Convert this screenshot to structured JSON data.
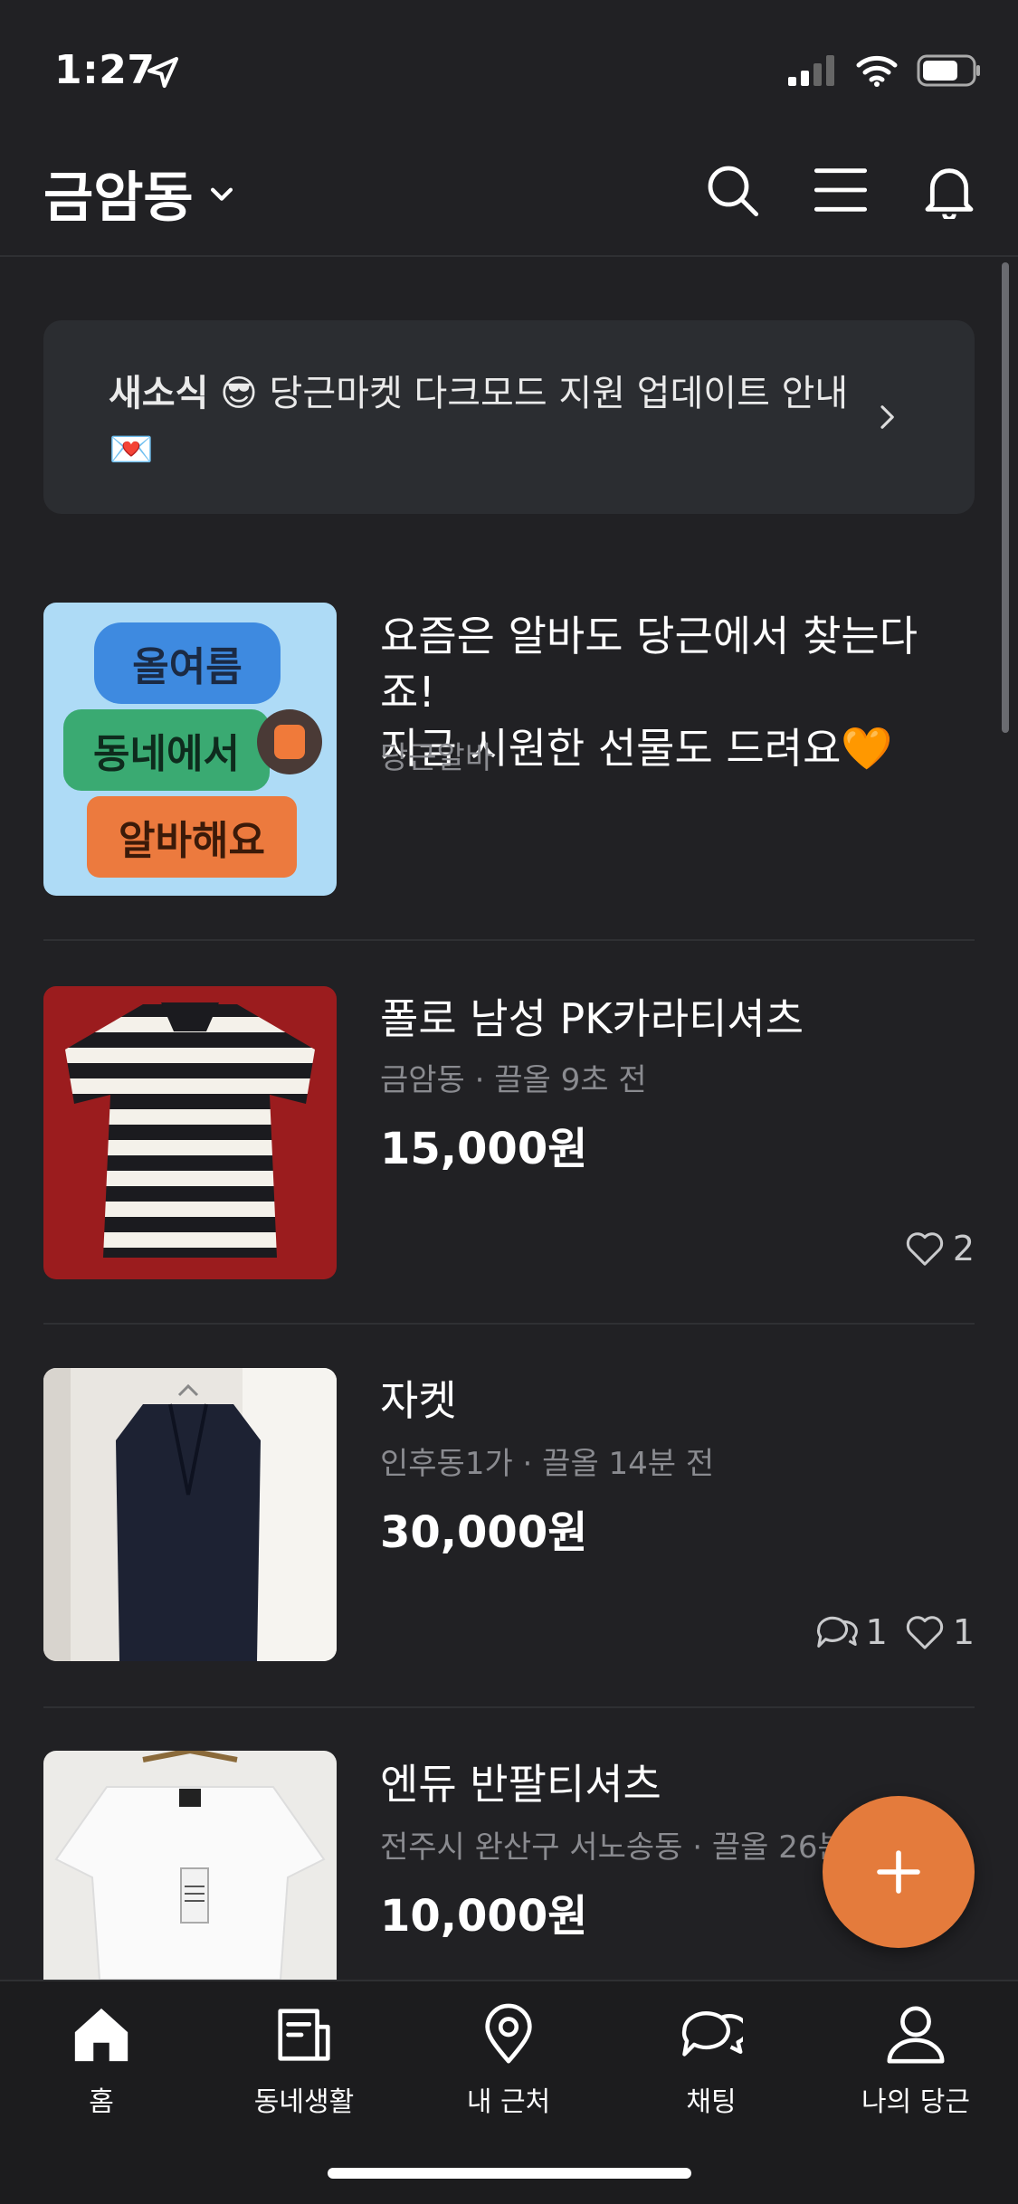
{
  "status_bar": {
    "time": "1:27"
  },
  "header": {
    "location": "금암동"
  },
  "notice": {
    "tag": "새소식",
    "text_before_emoji": "😎",
    "message": "당근마켓 다크모드 지원 업데이트 안내",
    "trailing_emoji": "💌"
  },
  "ad": {
    "title_line1": "요즘은 알바도 당근에서 찾는다죠!",
    "title_line2": "지금 시원한 선물도 드려요",
    "heart_emoji": "🧡",
    "source": "당근알바",
    "pill1": "올여름",
    "pill2": "동네에서",
    "pill3": "알바해요"
  },
  "listings": [
    {
      "title": "폴로 남성 PK카라티셔츠",
      "meta": "금암동 · 끌올 9초 전",
      "price": "15,000원",
      "likes": "2"
    },
    {
      "title": "자켓",
      "meta": "인후동1가 · 끌올 14분 전",
      "price": "30,000원",
      "comments": "1",
      "likes": "1"
    },
    {
      "title": "엔듀 반팔티셔츠",
      "meta": "전주시 완산구 서노송동 · 끌올 26분",
      "price": "10,000원"
    }
  ],
  "tabs": [
    {
      "label": "홈",
      "icon": "home-icon"
    },
    {
      "label": "동네생활",
      "icon": "news-icon"
    },
    {
      "label": "내 근처",
      "icon": "location-pin-icon"
    },
    {
      "label": "채팅",
      "icon": "chat-icon"
    },
    {
      "label": "나의 당근",
      "icon": "person-icon"
    }
  ],
  "colors": {
    "accent": "#e47b3c",
    "background": "#212124"
  }
}
